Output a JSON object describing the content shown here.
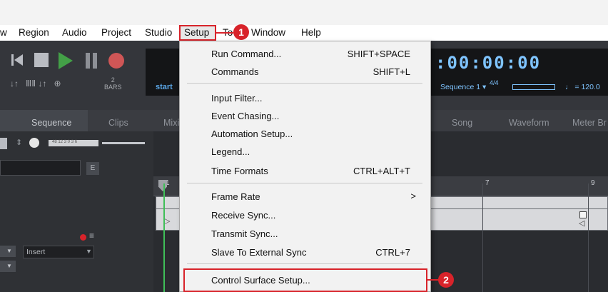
{
  "menubar": {
    "items": [
      "w",
      "Region",
      "Audio",
      "Project",
      "Studio",
      "Setup",
      "To",
      "Window",
      "Help"
    ],
    "active": "Setup"
  },
  "callouts": [
    "1",
    "2"
  ],
  "transport": {
    "bars_value": "2",
    "bars_unit": "BARS",
    "start_label": "start",
    "timecode": ":00:00:00",
    "sequence_label": "Sequence 1 ▾",
    "time_signature": "4/4",
    "tempo": "= 120.0",
    "counter_small": "48 12 3 0 3 6"
  },
  "tabs": [
    "Sequence",
    "Clips",
    "Mixi",
    "Song",
    "Waveform",
    "Meter Br"
  ],
  "panel": {
    "e_button": "E",
    "insert_label": "Insert"
  },
  "ruler": [
    "1",
    "7",
    "9"
  ],
  "dropdown": {
    "items": [
      {
        "label": "Run Command...",
        "shortcut": "SHIFT+SPACE"
      },
      {
        "label": "Commands",
        "shortcut": "SHIFT+L"
      },
      {
        "label": "Input Filter...",
        "shortcut": ""
      },
      {
        "label": "Event Chasing...",
        "shortcut": ""
      },
      {
        "label": "Automation Setup...",
        "shortcut": ""
      },
      {
        "label": "Legend...",
        "shortcut": ""
      },
      {
        "label": "Time Formats",
        "shortcut": "CTRL+ALT+T"
      },
      {
        "label": "Frame Rate",
        "shortcut": ">"
      },
      {
        "label": "Receive Sync...",
        "shortcut": ""
      },
      {
        "label": "Transmit Sync...",
        "shortcut": ""
      },
      {
        "label": "Slave To External Sync",
        "shortcut": "CTRL+7"
      },
      {
        "label": "Control Surface Setup...",
        "shortcut": ""
      }
    ]
  },
  "colors": {
    "callout_red": "#d8232a",
    "play_green": "#43a047",
    "timecode_blue": "#7fc4ff"
  }
}
